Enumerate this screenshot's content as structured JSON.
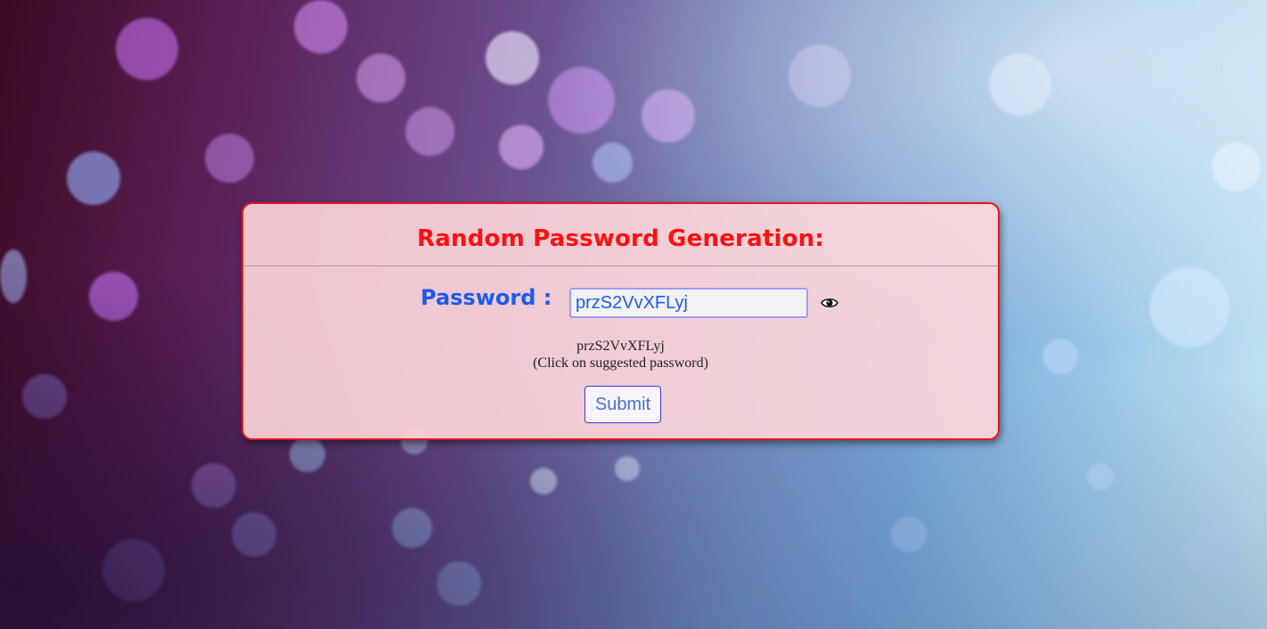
{
  "card": {
    "title": "Random Password Generation:",
    "border_color": "#e8141e",
    "background_color": "#ffd7da"
  },
  "password": {
    "label": "Password :",
    "value": "przS2VvXFLyj",
    "toggle_icon": "eye-icon"
  },
  "suggestion": {
    "password": "przS2VvXFLyj",
    "hint": "(Click on suggested password)"
  },
  "submit": {
    "label": "Submit"
  },
  "colors": {
    "title": "#ff1010",
    "label": "#1a5cf0",
    "submit_text": "#4a72c8",
    "submit_border": "#3a3adf"
  }
}
